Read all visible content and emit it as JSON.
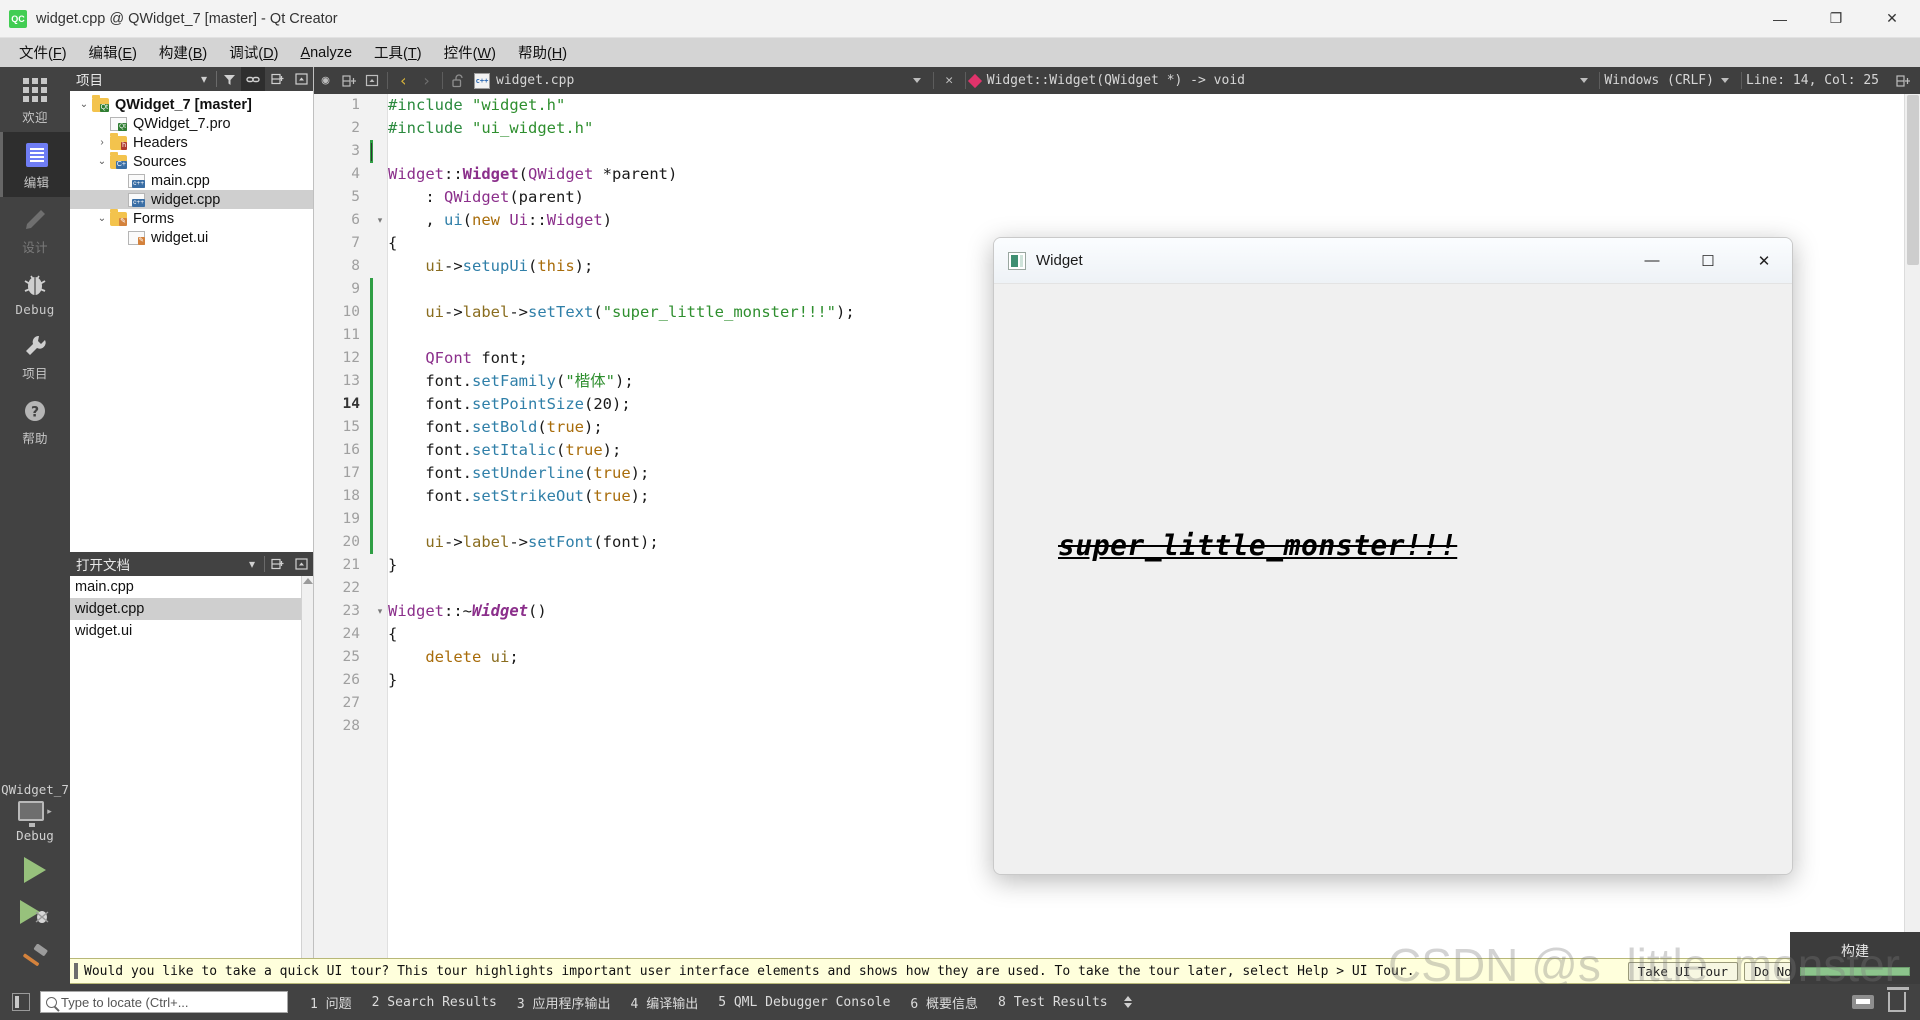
{
  "window": {
    "title": "widget.cpp @ QWidget_7 [master] - Qt Creator",
    "app_icon": "QC",
    "minimize": "—",
    "maximize": "❐",
    "close": "✕"
  },
  "menubar": [
    {
      "label": "文件(F)",
      "key": "F"
    },
    {
      "label": "编辑(E)",
      "key": "E"
    },
    {
      "label": "构建(B)",
      "key": "B"
    },
    {
      "label": "调试(D)",
      "key": "D"
    },
    {
      "label": "Analyze",
      "key": "A"
    },
    {
      "label": "工具(T)",
      "key": "T"
    },
    {
      "label": "控件(W)",
      "key": "W"
    },
    {
      "label": "帮助(H)",
      "key": "H"
    }
  ],
  "modebar": {
    "items": [
      {
        "label": "欢迎",
        "icon": "grid-icon",
        "state": "normal"
      },
      {
        "label": "编辑",
        "icon": "document-icon",
        "state": "active"
      },
      {
        "label": "设计",
        "icon": "pencil-icon",
        "state": "disabled"
      },
      {
        "label": "Debug",
        "icon": "bug-icon",
        "state": "normal"
      },
      {
        "label": "项目",
        "icon": "wrench-icon",
        "state": "normal"
      },
      {
        "label": "帮助",
        "icon": "question-icon",
        "state": "normal"
      }
    ],
    "kit_name": "QWidget_7",
    "kit_mode": "Debug",
    "run_tooltip": "Run",
    "debug_tooltip": "Start Debugging",
    "build_tooltip": "Build"
  },
  "project_panel": {
    "title": "项目",
    "filter_icon": "filter-icon",
    "link_icon": "link-icon",
    "split_icon": "split-icon",
    "close_icon": "close-panel-icon",
    "tree": [
      {
        "label": "QWidget_7 [master]",
        "indent": 0,
        "twist": "⌄",
        "icon": "folder-qt-icon",
        "bold": true,
        "selected": false
      },
      {
        "label": "QWidget_7.pro",
        "indent": 1,
        "twist": "",
        "icon": "file-pro-icon",
        "bold": false,
        "selected": false
      },
      {
        "label": "Headers",
        "indent": 1,
        "twist": "›",
        "icon": "folder-h-icon",
        "bold": false,
        "selected": false
      },
      {
        "label": "Sources",
        "indent": 1,
        "twist": "⌄",
        "icon": "folder-cpp-icon",
        "bold": false,
        "selected": false
      },
      {
        "label": "main.cpp",
        "indent": 2,
        "twist": "",
        "icon": "file-cpp-icon",
        "bold": false,
        "selected": false
      },
      {
        "label": "widget.cpp",
        "indent": 2,
        "twist": "",
        "icon": "file-cpp-icon",
        "bold": false,
        "selected": true
      },
      {
        "label": "Forms",
        "indent": 1,
        "twist": "⌄",
        "icon": "folder-ui-icon",
        "bold": false,
        "selected": false
      },
      {
        "label": "widget.ui",
        "indent": 2,
        "twist": "",
        "icon": "file-ui-icon",
        "bold": false,
        "selected": false
      }
    ]
  },
  "open_documents": {
    "title": "打开文档",
    "items": [
      {
        "label": "main.cpp",
        "selected": false
      },
      {
        "label": "widget.cpp",
        "selected": true
      },
      {
        "label": "widget.ui",
        "selected": false
      }
    ]
  },
  "editor_toolbar": {
    "back_icon": "back-arrow-icon",
    "forward_icon": "forward-arrow-icon",
    "lock_icon": "unlocked-icon",
    "split_icon": "split-editor-icon",
    "close_split_icon": "close-split-icon",
    "file_name": "widget.cpp",
    "file_icon": "cpp-file-icon",
    "close_doc_icon": "✕",
    "symbol": "Widget::Widget(QWidget *) -> void",
    "symbol_marker": "diamond-icon",
    "line_ending": "Windows (CRLF)",
    "cursor_position": "Line: 14, Col: 25",
    "split_right_icon": "split-right-icon"
  },
  "code": {
    "current_line": 14,
    "lines": [
      {
        "n": 1,
        "fold": "",
        "mark": "",
        "tokens": [
          {
            "t": "#include ",
            "c": "k-pre"
          },
          {
            "t": "\"widget.h\"",
            "c": "k-str"
          }
        ]
      },
      {
        "n": 2,
        "fold": "",
        "mark": "",
        "tokens": [
          {
            "t": "#include ",
            "c": "k-pre"
          },
          {
            "t": "\"ui_widget.h\"",
            "c": "k-str"
          }
        ]
      },
      {
        "n": 3,
        "fold": "",
        "mark": "caret",
        "tokens": []
      },
      {
        "n": 4,
        "fold": "",
        "mark": "",
        "tokens": [
          {
            "t": "Widget",
            "c": "k-type"
          },
          {
            "t": "::",
            "c": "k-plain"
          },
          {
            "t": "Widget",
            "c": "k-type b"
          },
          {
            "t": "(",
            "c": "k-plain"
          },
          {
            "t": "QWidget",
            "c": "k-type"
          },
          {
            "t": " *parent)",
            "c": "k-plain"
          }
        ]
      },
      {
        "n": 5,
        "fold": "",
        "mark": "",
        "tokens": [
          {
            "t": "    : ",
            "c": "k-plain"
          },
          {
            "t": "QWidget",
            "c": "k-type"
          },
          {
            "t": "(parent)",
            "c": "k-plain"
          }
        ]
      },
      {
        "n": 6,
        "fold": "▾",
        "mark": "",
        "tokens": [
          {
            "t": "    , ",
            "c": "k-plain"
          },
          {
            "t": "ui",
            "c": "k-fn"
          },
          {
            "t": "(",
            "c": "k-plain"
          },
          {
            "t": "new",
            "c": "k-kw"
          },
          {
            "t": " ",
            "c": "k-plain"
          },
          {
            "t": "Ui",
            "c": "k-type"
          },
          {
            "t": "::",
            "c": "k-plain"
          },
          {
            "t": "Widget",
            "c": "k-type"
          },
          {
            "t": ")",
            "c": "k-plain"
          }
        ]
      },
      {
        "n": 7,
        "fold": "",
        "mark": "",
        "tokens": [
          {
            "t": "{",
            "c": "k-plain"
          }
        ]
      },
      {
        "n": 8,
        "fold": "",
        "mark": "",
        "tokens": [
          {
            "t": "    ",
            "c": "k-plain"
          },
          {
            "t": "ui",
            "c": "k-var"
          },
          {
            "t": "->",
            "c": "k-plain"
          },
          {
            "t": "setupUi",
            "c": "k-fn"
          },
          {
            "t": "(",
            "c": "k-plain"
          },
          {
            "t": "this",
            "c": "k-kw"
          },
          {
            "t": ");",
            "c": "k-plain"
          }
        ]
      },
      {
        "n": 9,
        "fold": "",
        "mark": "caret",
        "tokens": []
      },
      {
        "n": 10,
        "fold": "",
        "mark": "green",
        "tokens": [
          {
            "t": "    ",
            "c": "k-plain"
          },
          {
            "t": "ui",
            "c": "k-var"
          },
          {
            "t": "->",
            "c": "k-plain"
          },
          {
            "t": "label",
            "c": "k-var"
          },
          {
            "t": "->",
            "c": "k-plain"
          },
          {
            "t": "setText",
            "c": "k-fn"
          },
          {
            "t": "(",
            "c": "k-plain"
          },
          {
            "t": "\"super_little_monster!!!\"",
            "c": "k-str"
          },
          {
            "t": ");",
            "c": "k-plain"
          }
        ]
      },
      {
        "n": 11,
        "fold": "",
        "mark": "green",
        "tokens": []
      },
      {
        "n": 12,
        "fold": "",
        "mark": "green",
        "tokens": [
          {
            "t": "    ",
            "c": "k-plain"
          },
          {
            "t": "QFont",
            "c": "k-type"
          },
          {
            "t": " font;",
            "c": "k-plain"
          }
        ]
      },
      {
        "n": 13,
        "fold": "",
        "mark": "green",
        "tokens": [
          {
            "t": "    font.",
            "c": "k-plain"
          },
          {
            "t": "setFamily",
            "c": "k-fn"
          },
          {
            "t": "(",
            "c": "k-plain"
          },
          {
            "t": "\"楷体\"",
            "c": "k-str"
          },
          {
            "t": ");",
            "c": "k-plain"
          }
        ]
      },
      {
        "n": 14,
        "fold": "",
        "mark": "green",
        "tokens": [
          {
            "t": "    font.",
            "c": "k-plain"
          },
          {
            "t": "setPointSize",
            "c": "k-fn"
          },
          {
            "t": "(",
            "c": "k-plain"
          },
          {
            "t": "20",
            "c": "k-num"
          },
          {
            "t": ");",
            "c": "k-plain"
          }
        ]
      },
      {
        "n": 15,
        "fold": "",
        "mark": "green",
        "tokens": [
          {
            "t": "    font.",
            "c": "k-plain"
          },
          {
            "t": "setBold",
            "c": "k-fn"
          },
          {
            "t": "(",
            "c": "k-plain"
          },
          {
            "t": "true",
            "c": "k-kw"
          },
          {
            "t": ");",
            "c": "k-plain"
          }
        ]
      },
      {
        "n": 16,
        "fold": "",
        "mark": "green",
        "tokens": [
          {
            "t": "    font.",
            "c": "k-plain"
          },
          {
            "t": "setItalic",
            "c": "k-fn"
          },
          {
            "t": "(",
            "c": "k-plain"
          },
          {
            "t": "true",
            "c": "k-kw"
          },
          {
            "t": ");",
            "c": "k-plain"
          }
        ]
      },
      {
        "n": 17,
        "fold": "",
        "mark": "green",
        "tokens": [
          {
            "t": "    font.",
            "c": "k-plain"
          },
          {
            "t": "setUnderline",
            "c": "k-fn"
          },
          {
            "t": "(",
            "c": "k-plain"
          },
          {
            "t": "true",
            "c": "k-kw"
          },
          {
            "t": ");",
            "c": "k-plain"
          }
        ]
      },
      {
        "n": 18,
        "fold": "",
        "mark": "green",
        "tokens": [
          {
            "t": "    font.",
            "c": "k-plain"
          },
          {
            "t": "setStrikeOut",
            "c": "k-fn"
          },
          {
            "t": "(",
            "c": "k-plain"
          },
          {
            "t": "true",
            "c": "k-kw"
          },
          {
            "t": ");",
            "c": "k-plain"
          }
        ]
      },
      {
        "n": 19,
        "fold": "",
        "mark": "green",
        "tokens": []
      },
      {
        "n": 20,
        "fold": "",
        "mark": "green",
        "tokens": [
          {
            "t": "    ",
            "c": "k-plain"
          },
          {
            "t": "ui",
            "c": "k-var"
          },
          {
            "t": "->",
            "c": "k-plain"
          },
          {
            "t": "label",
            "c": "k-var"
          },
          {
            "t": "->",
            "c": "k-plain"
          },
          {
            "t": "setFont",
            "c": "k-fn"
          },
          {
            "t": "(font);",
            "c": "k-plain"
          }
        ]
      },
      {
        "n": 21,
        "fold": "",
        "mark": "",
        "tokens": [
          {
            "t": "}",
            "c": "k-plain"
          }
        ]
      },
      {
        "n": 22,
        "fold": "",
        "mark": "",
        "tokens": []
      },
      {
        "n": 23,
        "fold": "▾",
        "mark": "",
        "tokens": [
          {
            "t": "Widget",
            "c": "k-type"
          },
          {
            "t": "::~",
            "c": "k-plain"
          },
          {
            "t": "Widget",
            "c": "k-type b i"
          },
          {
            "t": "()",
            "c": "k-plain"
          }
        ]
      },
      {
        "n": 24,
        "fold": "",
        "mark": "",
        "tokens": [
          {
            "t": "{",
            "c": "k-plain"
          }
        ]
      },
      {
        "n": 25,
        "fold": "",
        "mark": "",
        "tokens": [
          {
            "t": "    ",
            "c": "k-plain"
          },
          {
            "t": "delete",
            "c": "k-kw"
          },
          {
            "t": " ",
            "c": "k-plain"
          },
          {
            "t": "ui",
            "c": "k-var"
          },
          {
            "t": ";",
            "c": "k-plain"
          }
        ]
      },
      {
        "n": 26,
        "fold": "",
        "mark": "",
        "tokens": [
          {
            "t": "}",
            "c": "k-plain"
          }
        ]
      },
      {
        "n": 27,
        "fold": "",
        "mark": "",
        "tokens": []
      },
      {
        "n": 28,
        "fold": "",
        "mark": "",
        "tokens": []
      }
    ]
  },
  "app_window": {
    "title": "Widget",
    "minimize": "—",
    "maximize": "☐",
    "close": "✕",
    "label_text": "super_little_monster!!!"
  },
  "tour_banner": {
    "message": "Would you like to take a quick UI tour? This tour highlights important user interface elements and shows how they are used. To take the tour later, select Help > UI Tour.",
    "take_button": "Take UI Tour",
    "dismiss_button": "Do Not Show Again",
    "close_icon": "✕"
  },
  "build_popup": {
    "label": "构建",
    "progress": 100
  },
  "statusbar": {
    "locator_placeholder": "Type to locate (Ctrl+...",
    "panels": [
      {
        "num": "1",
        "label": "问题"
      },
      {
        "num": "2",
        "label": "Search Results"
      },
      {
        "num": "3",
        "label": "应用程序输出"
      },
      {
        "num": "4",
        "label": "编译输出"
      },
      {
        "num": "5",
        "label": "QML Debugger Console"
      },
      {
        "num": "6",
        "label": "概要信息"
      },
      {
        "num": "8",
        "label": "Test Results"
      }
    ]
  },
  "watermark": "CSDN @s_little_monster",
  "colors": {
    "accent_green": "#41cd52",
    "modebar_bg": "#424242",
    "editor_bg": "#ffffff",
    "selection": "#cfcfcf",
    "tour_bg": "#ffffdc",
    "change_marker": "#2f9e44"
  }
}
